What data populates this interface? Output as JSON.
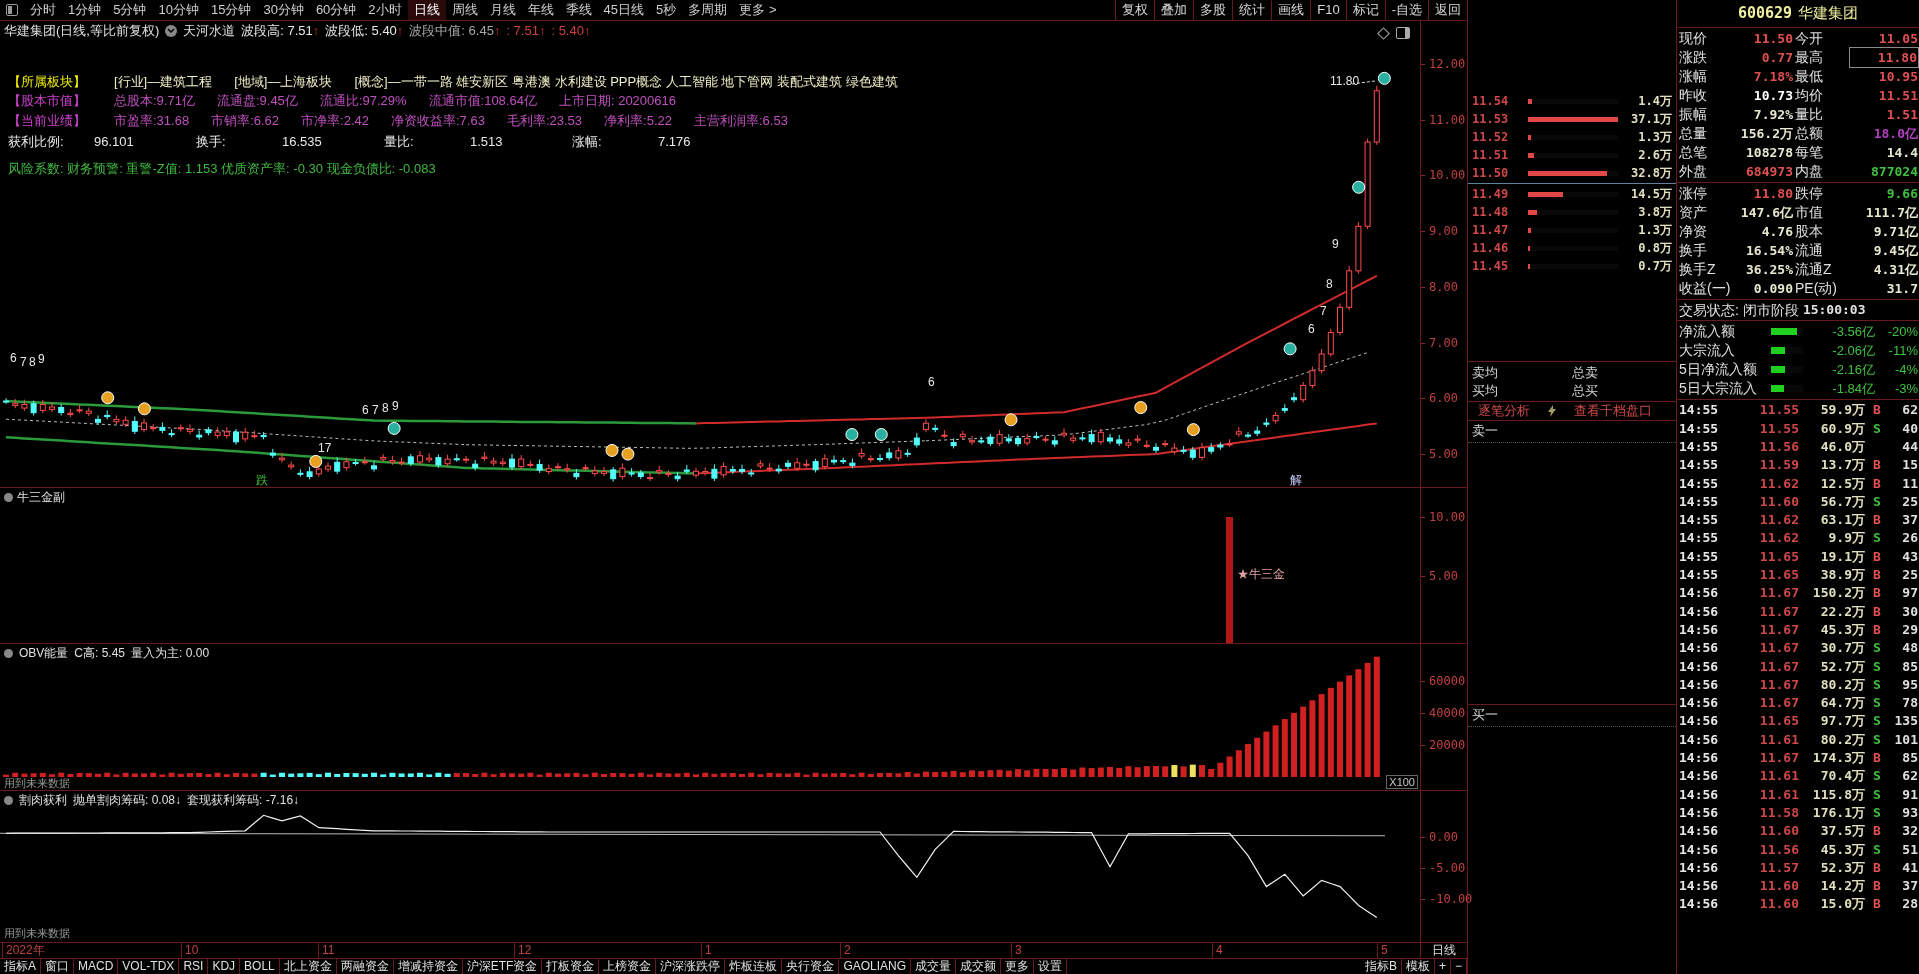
{
  "toolbar": {
    "periods": [
      {
        "label": "分时",
        "selected": false
      },
      {
        "label": "1分钟",
        "selected": false
      },
      {
        "label": "5分钟",
        "selected": false
      },
      {
        "label": "10分钟",
        "selected": false
      },
      {
        "label": "15分钟",
        "selected": false
      },
      {
        "label": "30分钟",
        "selected": false
      },
      {
        "label": "60分钟",
        "selected": false
      },
      {
        "label": "2小时",
        "selected": false
      },
      {
        "label": "日线",
        "selected": true
      },
      {
        "label": "周线",
        "selected": false
      },
      {
        "label": "月线",
        "selected": false
      },
      {
        "label": "年线",
        "selected": false
      },
      {
        "label": "季线",
        "selected": false
      },
      {
        "label": "45日线",
        "selected": false
      },
      {
        "label": "5秒",
        "selected": false
      },
      {
        "label": "多周期",
        "selected": false
      },
      {
        "label": "更多 >",
        "selected": false
      }
    ],
    "buttons": [
      "复权",
      "叠加",
      "多股",
      "统计",
      "画线",
      "F10",
      "标记",
      "-自选",
      "返回"
    ]
  },
  "price_panel": {
    "title": "华建集团(日线,等比前复权)",
    "indicator": "天河水道",
    "indicator_values": [
      {
        "label": "波段高:",
        "value": "7.51",
        "arrow": "↑",
        "color": "#e8e8e8"
      },
      {
        "label": "波段低:",
        "value": "5.40",
        "arrow": "↑",
        "color": "#e8e8e8"
      },
      {
        "label": "波段中值:",
        "value": "6.45",
        "arrow": "↑",
        "color": "#a8a8a8"
      },
      {
        "label": ":",
        "value": "7.51",
        "arrow": "↑",
        "color": "#d04040"
      },
      {
        "label": ":",
        "value": "5.40",
        "arrow": "↑",
        "color": "#d04040"
      }
    ],
    "info_lines": [
      {
        "kind": "sector",
        "label": "【所属板块】",
        "items": [
          "[行业]—建筑工程",
          "[地域]—上海板块",
          "[概念]—一带一路 雄安新区 粤港澳 水利建设 PPP概念 人工智能 地下管网 装配式建筑 绿色建筑"
        ]
      },
      {
        "kind": "finance",
        "label": "【股本市值】",
        "items": [
          "总股本:9.71亿",
          "流通盘:9.45亿",
          "流通比:97.29%",
          "流通市值:108.64亿",
          "上市日期: 20200616"
        ]
      },
      {
        "kind": "finance",
        "label": "【当前业绩】",
        "items": [
          "市盈率:31.68",
          "市销率:6.62",
          "市净率:2.42",
          "净资收益率:7.63",
          "毛利率:23.53",
          "净利率:5.22",
          "主营利润率:6.53"
        ]
      },
      {
        "kind": "stats",
        "items": [
          "获利比例:",
          "96.101",
          "换手:",
          "16.535",
          "量比:",
          "1.513",
          "涨幅:",
          "7.176"
        ]
      },
      {
        "kind": "risk",
        "text": "风险系数: 财务预警: 重警-Z值: 1.153 优质资产率: -0.30 现金负债比: -0.083"
      }
    ],
    "annotations": [
      {
        "text": "11.80"
      },
      {
        "text": "6"
      },
      {
        "text": "7"
      },
      {
        "text": "8"
      },
      {
        "text": "9"
      },
      {
        "text": "6"
      },
      {
        "text": "7"
      },
      {
        "text": "8"
      },
      {
        "text": "9"
      },
      {
        "text": "6"
      },
      {
        "text": "7"
      },
      {
        "text": "8"
      },
      {
        "text": "9"
      },
      {
        "text": "6"
      },
      {
        "text": "跌"
      },
      {
        "text": "解"
      },
      {
        "text": "17"
      }
    ],
    "yticks": [
      "12.00",
      "11.00",
      "10.00",
      "9.00",
      "8.00",
      "7.00",
      "6.00",
      "5.00"
    ]
  },
  "sub_panel": {
    "title": "牛三金副",
    "signal_label": "★牛三金",
    "yticks": [
      "10.00",
      "5.00"
    ]
  },
  "obv_panel": {
    "title": "OBV能量",
    "values": [
      "C高: 5.45",
      "量入为主: 0.00"
    ],
    "scale_label": "X100",
    "note": "用到未来数据",
    "yticks": [
      "60000",
      "40000",
      "20000"
    ]
  },
  "profit_panel": {
    "title": "割肉获利",
    "values": [
      "抛单割肉筹码: 0.08↓",
      "套现获利筹码: -7.16↓"
    ],
    "note": "用到未来数据",
    "yticks": [
      "0.00",
      "-5.00",
      "-10.00"
    ]
  },
  "date_axis": {
    "labels": [
      "2022年",
      "10",
      "11",
      "12",
      "1",
      "2",
      "3",
      "4",
      "5"
    ],
    "period": "日线"
  },
  "bottom_tabs": {
    "left": [
      {
        "label": "指标A",
        "selected": false
      },
      {
        "label": "窗口",
        "selected": false
      },
      {
        "label": "MACD",
        "selected": false
      },
      {
        "label": "VOL-TDX",
        "selected": false
      },
      {
        "label": "RSI",
        "selected": false
      },
      {
        "label": "KDJ",
        "selected": false
      },
      {
        "label": "BOLL",
        "selected": false
      },
      {
        "label": "北上资金",
        "selected": false
      },
      {
        "label": "两融资金",
        "selected": false
      },
      {
        "label": "增减持资金",
        "selected": false
      },
      {
        "label": "沪深ETF资金",
        "selected": false
      },
      {
        "label": "打板资金",
        "selected": false
      },
      {
        "label": "上榜资金",
        "selected": false
      },
      {
        "label": "沪深涨跌停",
        "selected": false
      },
      {
        "label": "炸板连板",
        "selected": false
      },
      {
        "label": "央行资金",
        "selected": false
      },
      {
        "label": "GAOLIANG",
        "selected": false
      },
      {
        "label": "成交量",
        "selected": false
      },
      {
        "label": "成交额",
        "selected": false
      },
      {
        "label": "更多",
        "selected": false
      },
      {
        "label": "设置",
        "selected": false
      }
    ],
    "right": [
      {
        "label": "指标B",
        "selected": false
      },
      {
        "label": "模板",
        "selected": false
      },
      {
        "label": "+",
        "selected": false
      },
      {
        "label": "−",
        "selected": false
      }
    ]
  },
  "order_book": {
    "asks": [
      {
        "price": "11.54",
        "level": 0.04,
        "volume": "1.4万"
      },
      {
        "price": "11.53",
        "level": 1,
        "volume": "37.1万"
      },
      {
        "price": "11.52",
        "level": 0.035,
        "volume": "1.3万"
      },
      {
        "price": "11.51",
        "level": 0.07,
        "volume": "2.6万"
      },
      {
        "price": "11.50",
        "level": 0.88,
        "volume": "32.8万"
      }
    ],
    "bids": [
      {
        "price": "11.49",
        "level": 0.39,
        "volume": "14.5万"
      },
      {
        "price": "11.48",
        "level": 0.1,
        "volume": "3.8万"
      },
      {
        "price": "11.47",
        "level": 0.035,
        "volume": "1.3万"
      },
      {
        "price": "11.46",
        "level": 0.02,
        "volume": "0.8万"
      },
      {
        "price": "11.45",
        "level": 0.02,
        "volume": "0.7万"
      }
    ],
    "summary": [
      "卖均",
      "总卖",
      "买均",
      "总买"
    ],
    "links": [
      "逐笔分析",
      "查看千档盘口"
    ],
    "ask1_label": "卖一",
    "bid1_label": "买一"
  },
  "quote": {
    "code": "600629",
    "name": "华建集团",
    "section1": [
      [
        {
          "label": "现价"
        },
        {
          "value": "11.50",
          "color": "#e05050"
        },
        {
          "label": "今开"
        },
        {
          "value": "11.05",
          "color": "#e05050"
        }
      ],
      [
        {
          "label": "涨跌"
        },
        {
          "value": "0.77",
          "color": "#e05050"
        },
        {
          "label": "最高"
        },
        {
          "value": "11.80",
          "color": "#e05050",
          "boxed": true
        }
      ],
      [
        {
          "label": "涨幅"
        },
        {
          "value": "7.18%",
          "color": "#e05050"
        },
        {
          "label": "最低"
        },
        {
          "value": "10.95",
          "color": "#e05050"
        }
      ],
      [
        {
          "label": "昨收"
        },
        {
          "value": "10.73",
          "color": "#ffffff"
        },
        {
          "label": "均价"
        },
        {
          "value": "11.51",
          "color": "#e05050"
        }
      ],
      [
        {
          "label": "振幅"
        },
        {
          "value": "7.92%",
          "color": "#e8e8d0"
        },
        {
          "label": "量比"
        },
        {
          "value": "1.51",
          "color": "#e05050"
        }
      ],
      [
        {
          "label": "总量"
        },
        {
          "value": "156.2万",
          "color": "#e8e8d0"
        },
        {
          "label": "总额"
        },
        {
          "value": "18.0亿",
          "color": "#b040c0"
        }
      ],
      [
        {
          "label": "总笔"
        },
        {
          "value": "108278",
          "color": "#e8e8d0"
        },
        {
          "label": "每笔"
        },
        {
          "value": "14.4",
          "color": "#e8e8d0"
        }
      ],
      [
        {
          "label": "外盘"
        },
        {
          "value": "684973",
          "color": "#e05050"
        },
        {
          "label": "内盘"
        },
        {
          "value": "877024",
          "color": "#40c040"
        }
      ]
    ],
    "section2": [
      [
        {
          "label": "涨停"
        },
        {
          "value": "11.80",
          "color": "#e05050"
        },
        {
          "label": "跌停"
        },
        {
          "value": "9.66",
          "color": "#40c040"
        }
      ],
      [
        {
          "label": "资产"
        },
        {
          "value": "147.6亿",
          "color": "#e8e8d0"
        },
        {
          "label": "市值"
        },
        {
          "value": "111.7亿",
          "color": "#e8e8d0"
        }
      ],
      [
        {
          "label": "净资"
        },
        {
          "value": "4.76",
          "color": "#e8e8d0"
        },
        {
          "label": "股本"
        },
        {
          "value": "9.71亿",
          "color": "#e8e8d0"
        }
      ],
      [
        {
          "label": "换手"
        },
        {
          "value": "16.54%",
          "color": "#e8e8d0"
        },
        {
          "label": "流通"
        },
        {
          "value": "9.45亿",
          "color": "#e8e8d0"
        }
      ],
      [
        {
          "label": "换手Z"
        },
        {
          "value": "36.25%",
          "color": "#e8e8d0"
        },
        {
          "label": "流通Z"
        },
        {
          "value": "4.31亿",
          "color": "#e8e8d0"
        }
      ],
      [
        {
          "label": "收益(一)"
        },
        {
          "value": "0.090",
          "color": "#e8e8d0"
        },
        {
          "label": "PE(动)"
        },
        {
          "value": "31.7",
          "color": "#e8e8d0"
        }
      ]
    ],
    "status_label": "交易状态:",
    "status": "闭市阶段",
    "status_time": "15:00:03",
    "flows": [
      {
        "label": "净流入额",
        "level": 0.8,
        "amount": "-3.56亿",
        "pct": "-20%"
      },
      {
        "label": "大宗流入",
        "level": 0.45,
        "amount": "-2.06亿",
        "pct": "-11%"
      },
      {
        "label": "5日净流入额",
        "level": 0.45,
        "amount": "-2.16亿",
        "pct": "-4%"
      },
      {
        "label": "5日大宗流入",
        "level": 0.4,
        "amount": "-1.84亿",
        "pct": "-3%"
      }
    ],
    "ticks": [
      {
        "time": "14:55",
        "price": "11.55",
        "volume": "59.9万",
        "side": "B",
        "color": "#e05050",
        "count": "62"
      },
      {
        "time": "14:55",
        "price": "11.55",
        "volume": "60.9万",
        "side": "S",
        "color": "#40c040",
        "count": "40"
      },
      {
        "time": "14:55",
        "price": "11.56",
        "volume": "46.0万",
        "count": "44"
      },
      {
        "time": "14:55",
        "price": "11.59",
        "volume": "13.7万",
        "side": "B",
        "color": "#e05050",
        "count": "15"
      },
      {
        "time": "14:55",
        "price": "11.62",
        "volume": "12.5万",
        "side": "B",
        "color": "#e05050",
        "count": "11"
      },
      {
        "time": "14:55",
        "price": "11.60",
        "volume": "56.7万",
        "side": "S",
        "color": "#40c040",
        "count": "25"
      },
      {
        "time": "14:55",
        "price": "11.62",
        "volume": "63.1万",
        "side": "B",
        "color": "#e05050",
        "count": "37"
      },
      {
        "time": "14:55",
        "price": "11.62",
        "volume": "9.9万",
        "side": "S",
        "color": "#40c040",
        "count": "26"
      },
      {
        "time": "14:55",
        "price": "11.65",
        "volume": "19.1万",
        "side": "B",
        "color": "#e05050",
        "count": "43"
      },
      {
        "time": "14:55",
        "price": "11.65",
        "volume": "38.9万",
        "side": "B",
        "color": "#e05050",
        "count": "25"
      },
      {
        "time": "14:56",
        "price": "11.67",
        "volume": "150.2万",
        "side": "B",
        "color": "#e05050",
        "count": "97"
      },
      {
        "time": "14:56",
        "price": "11.67",
        "volume": "22.2万",
        "side": "B",
        "color": "#e05050",
        "count": "30"
      },
      {
        "time": "14:56",
        "price": "11.67",
        "volume": "45.3万",
        "side": "B",
        "color": "#e05050",
        "count": "29"
      },
      {
        "time": "14:56",
        "price": "11.67",
        "volume": "30.7万",
        "side": "S",
        "color": "#40c040",
        "count": "48"
      },
      {
        "time": "14:56",
        "price": "11.67",
        "volume": "52.7万",
        "side": "S",
        "color": "#40c040",
        "count": "85"
      },
      {
        "time": "14:56",
        "price": "11.67",
        "volume": "80.2万",
        "side": "S",
        "color": "#40c040",
        "count": "95"
      },
      {
        "time": "14:56",
        "price": "11.67",
        "volume": "64.7万",
        "side": "S",
        "color": "#40c040",
        "count": "78"
      },
      {
        "time": "14:56",
        "price": "11.65",
        "volume": "97.7万",
        "side": "S",
        "color": "#40c040",
        "count": "135"
      },
      {
        "time": "14:56",
        "price": "11.61",
        "volume": "80.2万",
        "side": "S",
        "color": "#40c040",
        "count": "101"
      },
      {
        "time": "14:56",
        "price": "11.67",
        "volume": "174.3万",
        "side": "B",
        "color": "#e05050",
        "count": "85"
      },
      {
        "time": "14:56",
        "price": "11.61",
        "volume": "70.4万",
        "side": "S",
        "color": "#40c040",
        "count": "62"
      },
      {
        "time": "14:56",
        "price": "11.61",
        "volume": "115.8万",
        "side": "S",
        "color": "#40c040",
        "count": "91"
      },
      {
        "time": "14:56",
        "price": "11.58",
        "volume": "176.1万",
        "side": "S",
        "color": "#40c040",
        "count": "93"
      },
      {
        "time": "14:56",
        "price": "11.60",
        "volume": "37.5万",
        "side": "B",
        "color": "#e05050",
        "count": "32"
      },
      {
        "time": "14:56",
        "price": "11.56",
        "volume": "45.3万",
        "side": "S",
        "color": "#40c040",
        "count": "51"
      },
      {
        "time": "14:56",
        "price": "11.57",
        "volume": "52.3万",
        "side": "B",
        "color": "#e05050",
        "count": "41"
      },
      {
        "time": "14:56",
        "price": "11.60",
        "volume": "14.2万",
        "side": "B",
        "color": "#e05050",
        "count": "37"
      },
      {
        "time": "14:56",
        "price": "11.60",
        "volume": "15.0万",
        "side": "B",
        "color": "#e05050",
        "count": "28"
      }
    ]
  }
}
